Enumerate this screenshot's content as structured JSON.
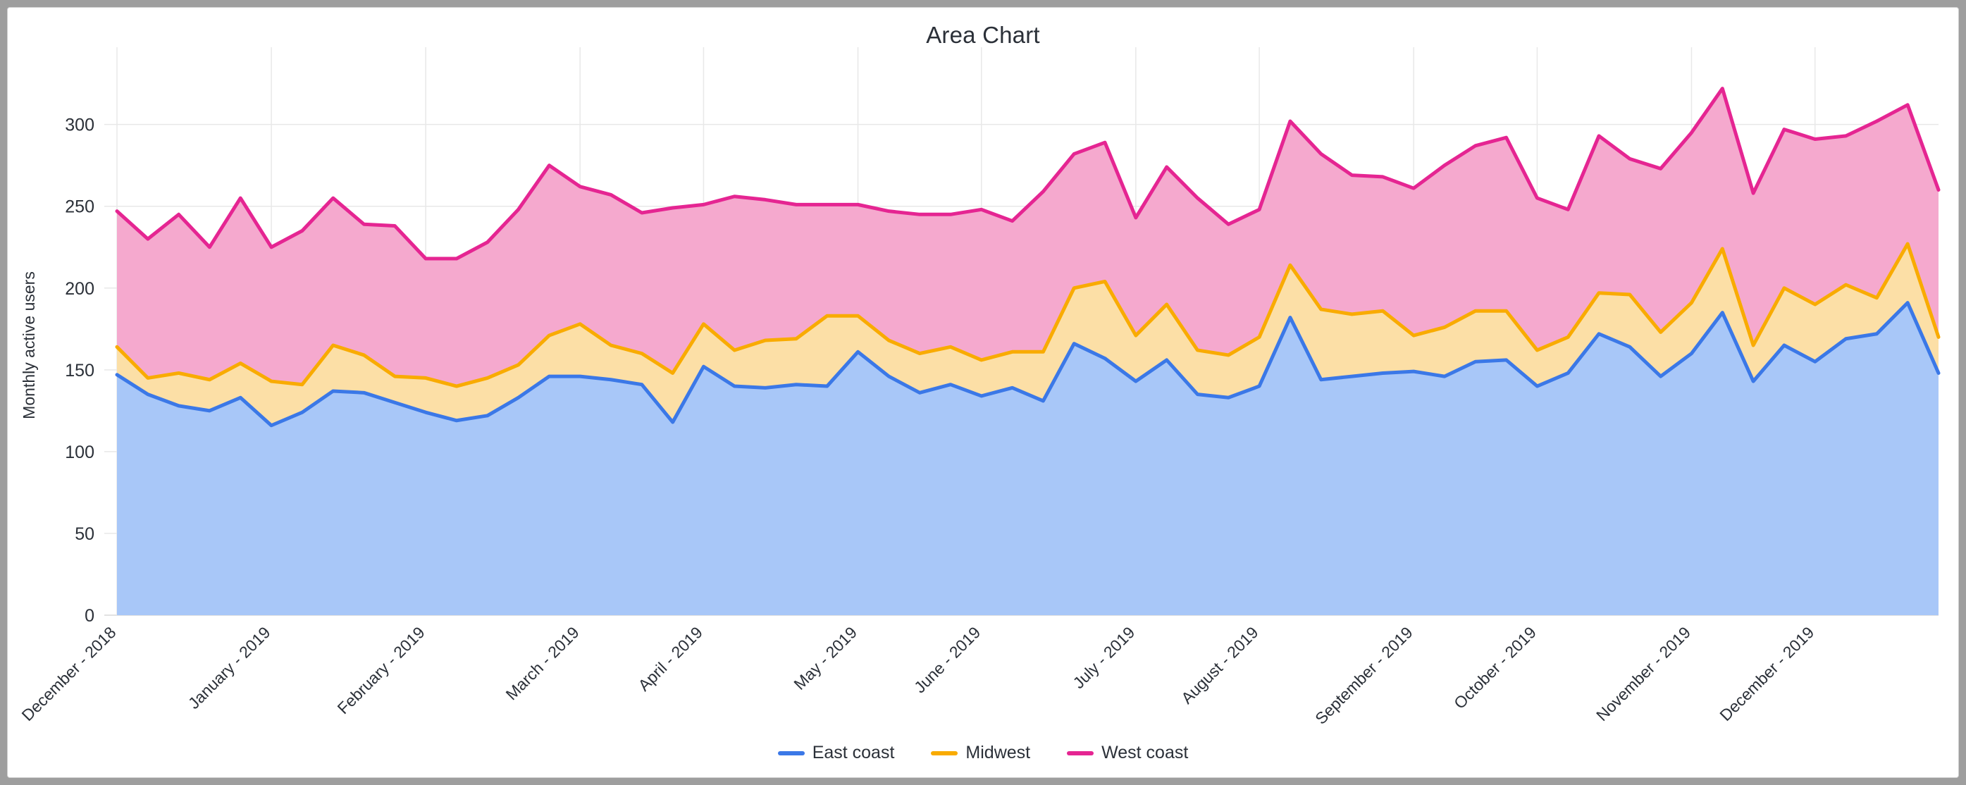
{
  "window": {
    "frame_color": "#9e9e9e"
  },
  "chart": {
    "title": "Area Chart"
  },
  "legend": {
    "items": [
      {
        "label": "East coast",
        "color": "#3b78e7"
      },
      {
        "label": "Midwest",
        "color": "#f9ab00"
      },
      {
        "label": "West coast",
        "color": "#e52592"
      }
    ]
  },
  "chart_data": {
    "type": "area",
    "stacked": true,
    "title": "Area Chart",
    "xlabel": "",
    "ylabel": "Monthly active users",
    "ylim": [
      0,
      330
    ],
    "yticks": [
      0,
      50,
      100,
      150,
      200,
      250,
      300
    ],
    "ytick_labels": [
      "0",
      "50",
      "100",
      "150",
      "200",
      "250",
      "300"
    ],
    "grid": true,
    "legend_position": "bottom",
    "x_tick_labels": [
      "December - 2018",
      "January - 2019",
      "February - 2019",
      "March - 2019",
      "April - 2019",
      "May - 2019",
      "June - 2019",
      "July - 2019",
      "August - 2019",
      "September - 2019",
      "October - 2019",
      "November - 2019",
      "December - 2019"
    ],
    "x_tick_indices": [
      0,
      5,
      10,
      15,
      19,
      24,
      28,
      33,
      37,
      42,
      46,
      51,
      55
    ],
    "x": [
      0,
      1,
      2,
      3,
      4,
      5,
      6,
      7,
      8,
      9,
      10,
      11,
      12,
      13,
      14,
      15,
      16,
      17,
      18,
      19,
      20,
      21,
      22,
      23,
      24,
      25,
      26,
      27,
      28,
      29,
      30,
      31,
      32,
      33,
      34,
      35,
      36,
      37,
      38,
      39,
      40,
      41,
      42,
      43,
      44,
      45,
      46,
      47,
      48,
      49,
      50,
      51,
      52,
      53,
      54,
      55,
      56,
      57
    ],
    "series": [
      {
        "name": "East coast",
        "color": "#3b78e7",
        "fill": "#a8c7f8",
        "values": [
          147,
          135,
          128,
          125,
          133,
          116,
          124,
          137,
          136,
          130,
          124,
          119,
          122,
          133,
          146,
          146,
          144,
          141,
          118,
          152,
          140,
          139,
          141,
          140,
          161,
          146,
          136,
          141,
          134,
          139,
          131,
          166,
          157,
          143,
          156,
          135,
          133,
          140,
          182,
          144,
          146,
          148,
          149,
          146,
          155,
          156,
          140,
          148,
          172,
          164,
          146,
          160,
          185,
          143,
          165,
          155,
          169,
          172,
          191,
          148
        ]
      },
      {
        "name": "Midwest",
        "color": "#f9ab00",
        "fill": "#fcdfa6",
        "values": [
          17,
          10,
          20,
          19,
          21,
          27,
          17,
          28,
          23,
          16,
          21,
          21,
          23,
          20,
          25,
          32,
          21,
          19,
          30,
          26,
          22,
          29,
          28,
          43,
          22,
          22,
          24,
          23,
          22,
          22,
          30,
          34,
          47,
          28,
          34,
          27,
          26,
          30,
          32,
          43,
          38,
          38,
          22,
          30,
          31,
          30,
          22,
          22,
          25,
          32,
          27,
          31,
          39,
          22,
          35,
          35,
          33,
          22,
          36,
          22
        ]
      },
      {
        "name": "West coast",
        "color": "#e52592",
        "fill": "#f5a9ce",
        "values": [
          83,
          85,
          97,
          81,
          101,
          82,
          94,
          90,
          80,
          92,
          73,
          78,
          83,
          95,
          104,
          84,
          92,
          86,
          101,
          73,
          94,
          86,
          82,
          68,
          68,
          79,
          85,
          81,
          92,
          80,
          98,
          82,
          85,
          72,
          84,
          93,
          80,
          78,
          88,
          95,
          85,
          82,
          90,
          99,
          101,
          106,
          93,
          78,
          96,
          83,
          100,
          104,
          98,
          93,
          97,
          101,
          91,
          108,
          85,
          90
        ]
      }
    ]
  }
}
